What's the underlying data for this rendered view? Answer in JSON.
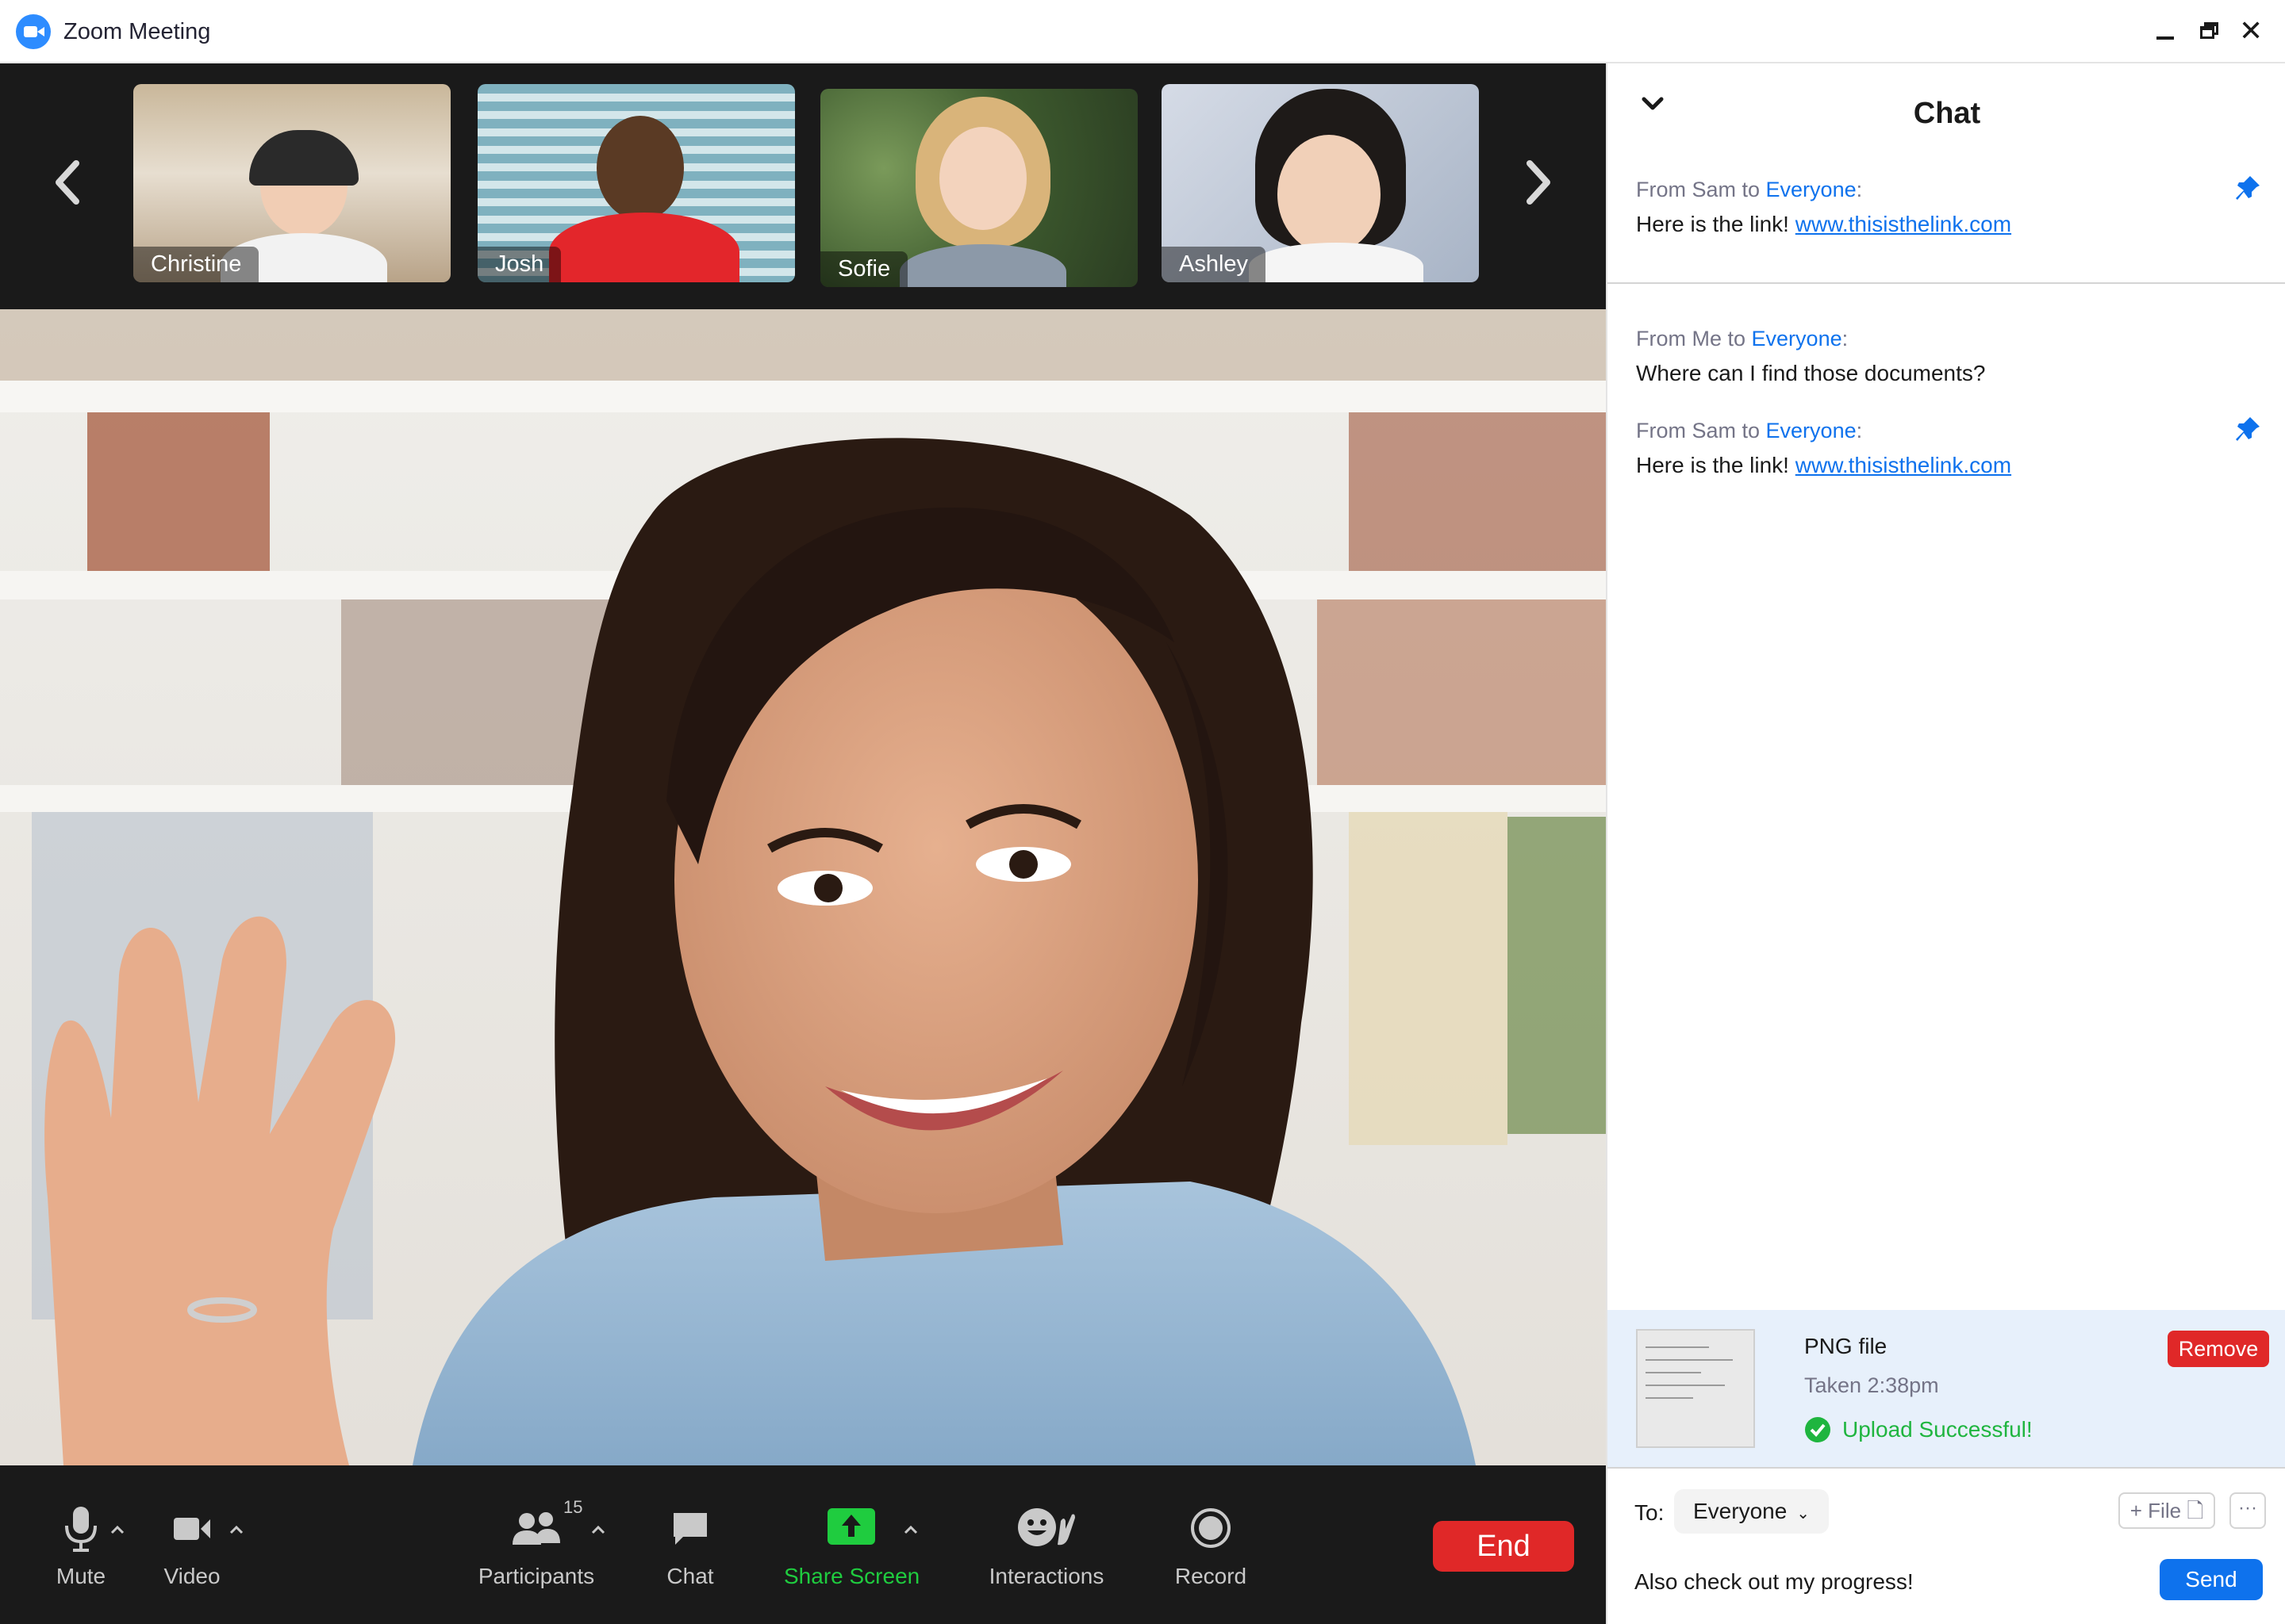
{
  "window": {
    "title": "Zoom Meeting",
    "logo_icon": "zoom-camera-icon",
    "controls": [
      "minimize-icon",
      "maximize-icon",
      "close-icon"
    ]
  },
  "gallery": {
    "prev_icon": "chevron-left-icon",
    "next_icon": "chevron-right-icon",
    "participants": [
      {
        "name": "Christine"
      },
      {
        "name": "Josh"
      },
      {
        "name": "Sofie"
      },
      {
        "name": "Ashley"
      }
    ]
  },
  "toolbar": {
    "mute_label": "Mute",
    "video_label": "Video",
    "participants_label": "Participants",
    "participants_count": "15",
    "chat_label": "Chat",
    "share_label": "Share Screen",
    "interactions_label": "Interactions",
    "record_label": "Record",
    "end_label": "End"
  },
  "chat": {
    "title": "Chat",
    "pinned": {
      "from_prefix": "From Sam to ",
      "to": "Everyone",
      "from_suffix": ":",
      "text": "Here is the link! ",
      "link": "www.thisisthelink.com"
    },
    "messages": [
      {
        "from_prefix": "From Me to ",
        "to": "Everyone",
        "from_suffix": ":",
        "text": "Where can I find those documents?"
      },
      {
        "from_prefix": "From Sam to ",
        "to": "Everyone",
        "from_suffix": ":",
        "text": "Here is the link! ",
        "link": "www.thisisthelink.com"
      }
    ],
    "upload": {
      "name": "PNG file",
      "time": "Taken 2:38pm",
      "status": "Upload Successful!",
      "remove_label": "Remove"
    },
    "compose": {
      "to_label": "To:",
      "recipient": "Everyone",
      "file_label": "+ File",
      "more_label": "···",
      "input_value": "Also check out my progress!",
      "send_label": "Send"
    }
  },
  "colors": {
    "accent": "#0e72ed",
    "end_red": "#e02828",
    "share_green": "#1fcc3f",
    "success_green": "#1fb53f",
    "toolbar_bg": "#1a1a1a"
  }
}
